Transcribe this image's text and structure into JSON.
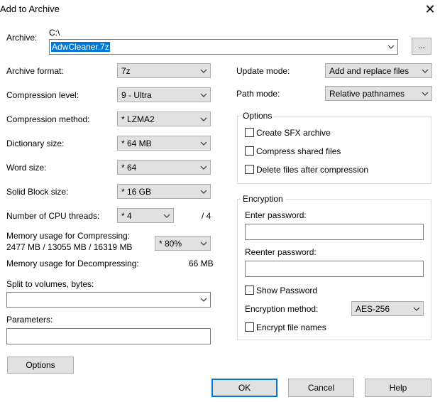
{
  "window": {
    "title": "Add to Archive",
    "close_glyph": "✕"
  },
  "archive": {
    "label": "Archive:",
    "path": "C:\\",
    "filename": "AdwCleaner.7z",
    "browse_label": "..."
  },
  "left": {
    "archive_format": {
      "label": "Archive format:",
      "value": "7z"
    },
    "compression_level": {
      "label": "Compression level:",
      "value": "9 - Ultra"
    },
    "compression_method": {
      "label": "Compression method:",
      "value": "*  LZMA2"
    },
    "dictionary_size": {
      "label": "Dictionary size:",
      "value": "*  64 MB"
    },
    "word_size": {
      "label": "Word size:",
      "value": "*  64"
    },
    "solid_block_size": {
      "label": "Solid Block size:",
      "value": "*  16 GB"
    },
    "cpu_threads": {
      "label": "Number of CPU threads:",
      "value": "*  4",
      "max": "/ 4"
    },
    "memory_compress": {
      "label": "Memory usage for Compressing:",
      "detail": "2477 MB / 13055 MB / 16319 MB",
      "value": "*  80%"
    },
    "memory_decompress": {
      "label": "Memory usage for Decompressing:",
      "value": "66 MB"
    },
    "split": {
      "label": "Split to volumes, bytes:",
      "value": ""
    },
    "parameters": {
      "label": "Parameters:",
      "value": ""
    },
    "options_button": "Options"
  },
  "right": {
    "update_mode": {
      "label": "Update mode:",
      "value": "Add and replace files"
    },
    "path_mode": {
      "label": "Path mode:",
      "value": "Relative pathnames"
    },
    "options_group": {
      "title": "Options",
      "create_sfx": "Create SFX archive",
      "compress_shared": "Compress shared files",
      "delete_after": "Delete files after compression"
    },
    "encryption": {
      "title": "Encryption",
      "enter_password": "Enter password:",
      "reenter_password": "Reenter password:",
      "show_password": "Show Password",
      "method_label": "Encryption method:",
      "method_value": "AES-256",
      "encrypt_names": "Encrypt file names"
    }
  },
  "buttons": {
    "ok": "OK",
    "cancel": "Cancel",
    "help": "Help"
  },
  "colors": {
    "accent": "#0078d7",
    "button_bg": "#e1e1e1",
    "border": "#adadad"
  }
}
